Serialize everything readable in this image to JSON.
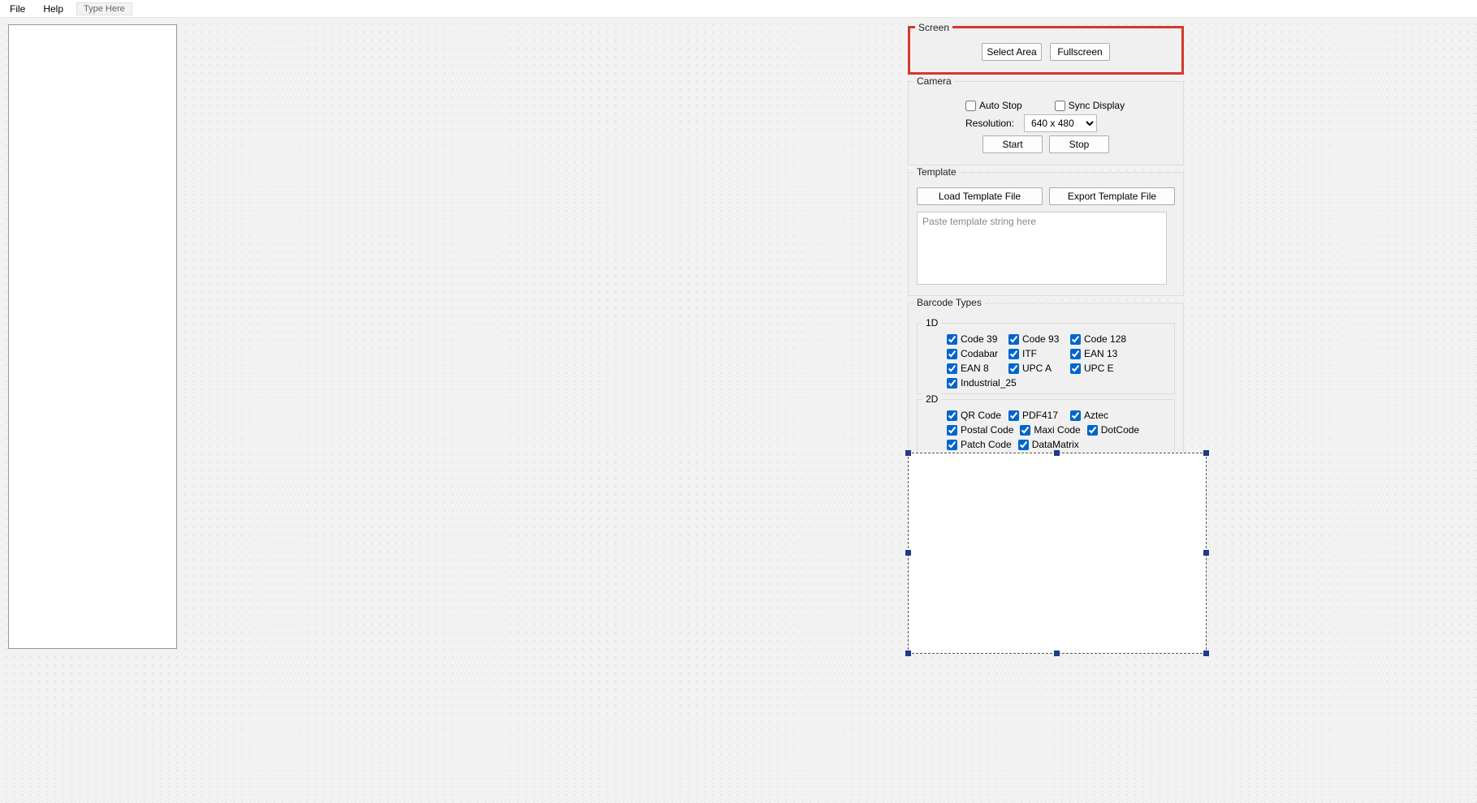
{
  "menu": {
    "file": "File",
    "help": "Help",
    "type_here": "Type Here"
  },
  "screen": {
    "title": "Screen",
    "select_area": "Select Area",
    "fullscreen": "Fullscreen",
    "highlighted": true
  },
  "camera": {
    "title": "Camera",
    "auto_stop_label": "Auto Stop",
    "auto_stop_checked": false,
    "sync_display_label": "Sync Display",
    "sync_display_checked": false,
    "resolution_label": "Resolution:",
    "resolution_value": "640 x 480",
    "resolution_options": [
      "640 x 480"
    ],
    "start": "Start",
    "stop": "Stop"
  },
  "template": {
    "title": "Template",
    "load": "Load Template File",
    "export": "Export Template File",
    "placeholder": "Paste template string here",
    "value": ""
  },
  "barcode": {
    "title": "Barcode Types",
    "one_d": {
      "title": "1D",
      "items": [
        {
          "label": "Code 39",
          "checked": true
        },
        {
          "label": "Code 93",
          "checked": true
        },
        {
          "label": "Code 128",
          "checked": true
        },
        {
          "label": "Codabar",
          "checked": true
        },
        {
          "label": "ITF",
          "checked": true
        },
        {
          "label": "EAN 13",
          "checked": true
        },
        {
          "label": "EAN 8",
          "checked": true
        },
        {
          "label": "UPC A",
          "checked": true
        },
        {
          "label": "UPC E",
          "checked": true
        },
        {
          "label": "Industrial_25",
          "checked": true
        }
      ]
    },
    "two_d": {
      "title": "2D",
      "items": [
        {
          "label": "QR Code",
          "checked": true
        },
        {
          "label": "PDF417",
          "checked": true
        },
        {
          "label": "Aztec",
          "checked": true
        },
        {
          "label": "Postal Code",
          "checked": true
        },
        {
          "label": "Maxi Code",
          "checked": true
        },
        {
          "label": "DotCode",
          "checked": true
        },
        {
          "label": "Patch Code",
          "checked": true
        },
        {
          "label": "DataMatrix",
          "checked": true
        }
      ]
    }
  }
}
